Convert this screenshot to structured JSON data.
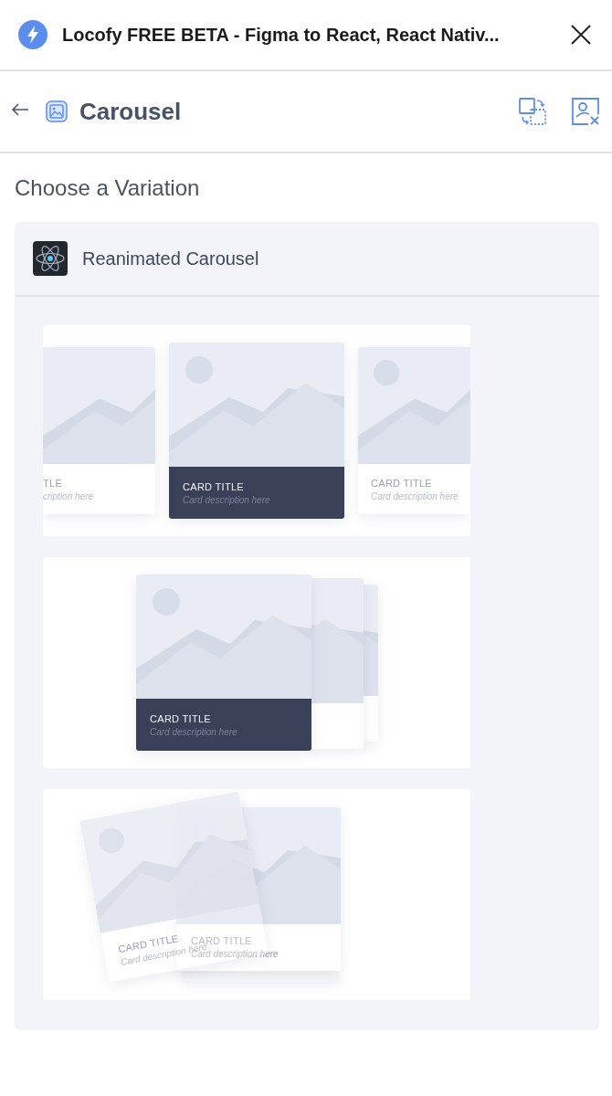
{
  "header": {
    "title": "Locofy FREE BETA - Figma to React, React Nativ..."
  },
  "toolbar": {
    "title": "Carousel"
  },
  "section_title": "Choose a Variation",
  "variation_group": {
    "name": "Reanimated Carousel",
    "previews": [
      {
        "kind": "row",
        "cards": [
          {
            "title": "TLE",
            "description": "cription here",
            "active": false
          },
          {
            "title": "CARD TITLE",
            "description": "Card description here",
            "active": true
          },
          {
            "title": "CARD TITLE",
            "description": "Card description here",
            "active": false
          }
        ]
      },
      {
        "kind": "stack",
        "cards": [
          {
            "title": "CARD TITLE",
            "description": "Card description here",
            "active": true
          }
        ]
      },
      {
        "kind": "tilt",
        "cards": [
          {
            "title": "CARD TITLE",
            "description": "Card description here",
            "active": false
          },
          {
            "title": "CARD TITLE",
            "description": "Card description here",
            "active": false
          }
        ]
      }
    ]
  }
}
